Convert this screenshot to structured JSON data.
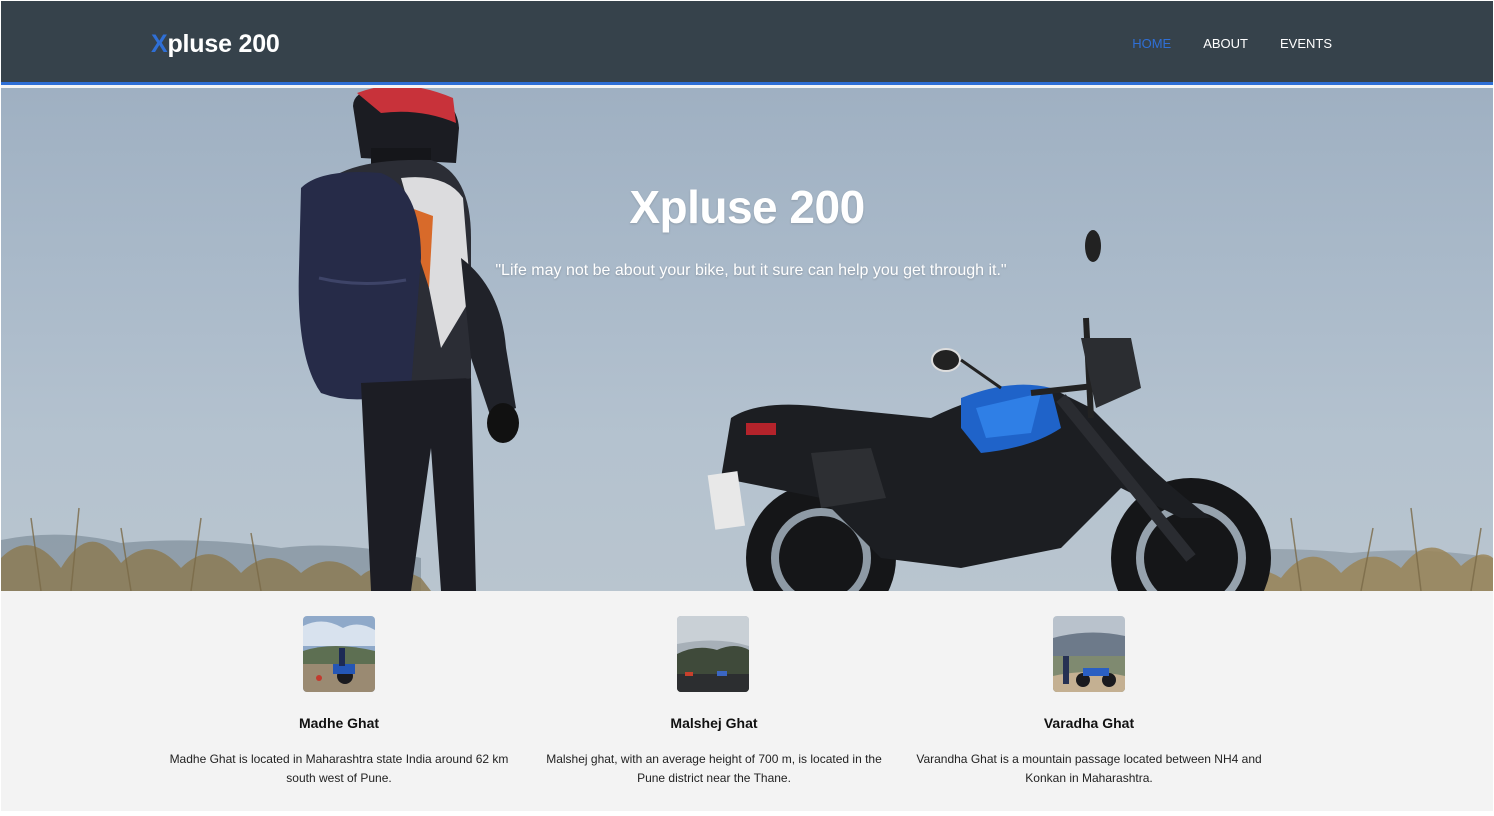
{
  "navbar": {
    "brand_initial": "X",
    "brand_rest": "pluse 200",
    "links": [
      {
        "label": "HOME",
        "active": true
      },
      {
        "label": "ABOUT",
        "active": false
      },
      {
        "label": "EVENTS",
        "active": false
      }
    ]
  },
  "hero": {
    "title": "Xpluse 200",
    "quote": "\"Life may not be about your bike, but it sure can help you get through it.\""
  },
  "cards": [
    {
      "title": "Madhe Ghat",
      "text": "Madhe Ghat is located in Maharashtra state India around 62 km south west of Pune."
    },
    {
      "title": "Malshej Ghat",
      "text": "Malshej ghat, with an average height of 700 m, is located in the Pune district near the Thane."
    },
    {
      "title": "Varadha Ghat",
      "text": "Varandha Ghat is a mountain passage located between NH4 and Konkan in Maharashtra."
    }
  ],
  "colors": {
    "navbar_bg": "#36424b",
    "accent": "#2f6fd6",
    "content_bg": "#f3f3f3"
  }
}
